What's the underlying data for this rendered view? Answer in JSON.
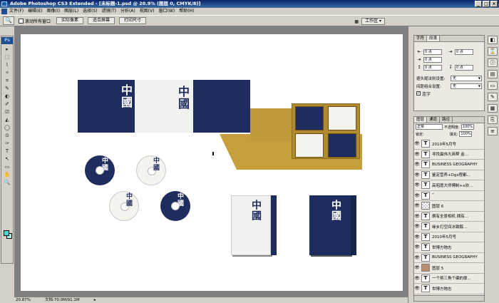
{
  "window": {
    "title": "Adobe Photoshop CS3 Extended - [未标题-1.psd @ 20.9% (图层 0, CMYK/8)]",
    "controls": [
      "_",
      "□",
      "×"
    ]
  },
  "menu": [
    "文件(F)",
    "编辑(E)",
    "图像(I)",
    "图层(L)",
    "选择(S)",
    "滤镜(T)",
    "分析(A)",
    "视图(V)",
    "窗口(W)",
    "帮助(H)"
  ],
  "options": {
    "tool_glyph": "🔍",
    "scroll_all_label": "滚动所有窗口",
    "buttons": [
      "实际像素",
      "适合屏幕",
      "打印尺寸"
    ],
    "workspace_label": "工作区 ▾",
    "workspace_glyph": "▦"
  },
  "toolbox": {
    "badge": "Ps",
    "tools": [
      "▸",
      "⬚",
      "⌇",
      "✧",
      "⌗",
      "✎",
      "◐",
      "✐",
      "⎚",
      "◭",
      "◯",
      "⊙",
      "✑",
      "T",
      "↖",
      "▭",
      "✋",
      "🔍"
    ]
  },
  "status": {
    "zoom": "20.87%",
    "doc": "文档:70.0M/91.1M",
    "arrow": "▸"
  },
  "character_panel": {
    "tabs": [
      "字符",
      "段落"
    ],
    "fields": [
      {
        "icon": "⇤",
        "value": "0 点",
        "icon2": "⇥",
        "value2": "0 点"
      },
      {
        "icon": "⇥",
        "value": "0 点",
        "icon2": "",
        "value2": ""
      },
      {
        "icon": "↥",
        "value": "0 点",
        "icon2": "↧",
        "value2": "0 点"
      }
    ],
    "selects": [
      {
        "label": "避头尾法则设置:",
        "value": "无"
      },
      {
        "label": "间距组合设置:",
        "value": "无"
      }
    ],
    "hyphen_label": "连字",
    "hyphen_checked": "✓"
  },
  "layers_panel": {
    "tabs": [
      "图层",
      "通道",
      "路径"
    ],
    "blend_mode": "正常",
    "opacity_label": "不透明度:",
    "opacity_value": "100%",
    "lock_label": "锁定:",
    "fill_label": "填充:",
    "fill_value": "100%",
    "eye": "👁",
    "layers": [
      {
        "type": "T",
        "name": "2010年5月号"
      },
      {
        "type": "T",
        "name": "寻找最伟大商帮 金..."
      },
      {
        "type": "T",
        "name": "BUSINESS GEOGRAPHY"
      },
      {
        "type": "T",
        "name": "鉴定营养+Dgx程都..."
      },
      {
        "type": "T",
        "name": "高昭度大师傅制+x欣..."
      },
      {
        "type": "T",
        "name": "“"
      },
      {
        "type": "checker",
        "name": "图层 6"
      },
      {
        "type": "T",
        "name": "拥有全景相机 拥有..."
      },
      {
        "type": "T",
        "name": "缘乡打空间冰致醇..."
      },
      {
        "type": "T",
        "name": "2010年5月号"
      },
      {
        "type": "T",
        "name": "世博方物志"
      },
      {
        "type": "T",
        "name": "BUSINESS GEOGRAPHY"
      },
      {
        "type": "img",
        "name": "图层 5"
      },
      {
        "type": "T",
        "name": "一个将三角个编的傻..."
      },
      {
        "type": "T",
        "name": "世博方物志"
      }
    ]
  },
  "panel_icons": [
    "◧",
    "⌛",
    "ⓘ",
    "▤",
    "▭",
    "✎",
    "▦",
    "⎘",
    "≡"
  ],
  "artwork": {
    "calligraphy": "中國",
    "colors": {
      "navy": "#1f2d5e",
      "gold": "#b08a2e",
      "paper": "#f1f1ef"
    }
  }
}
